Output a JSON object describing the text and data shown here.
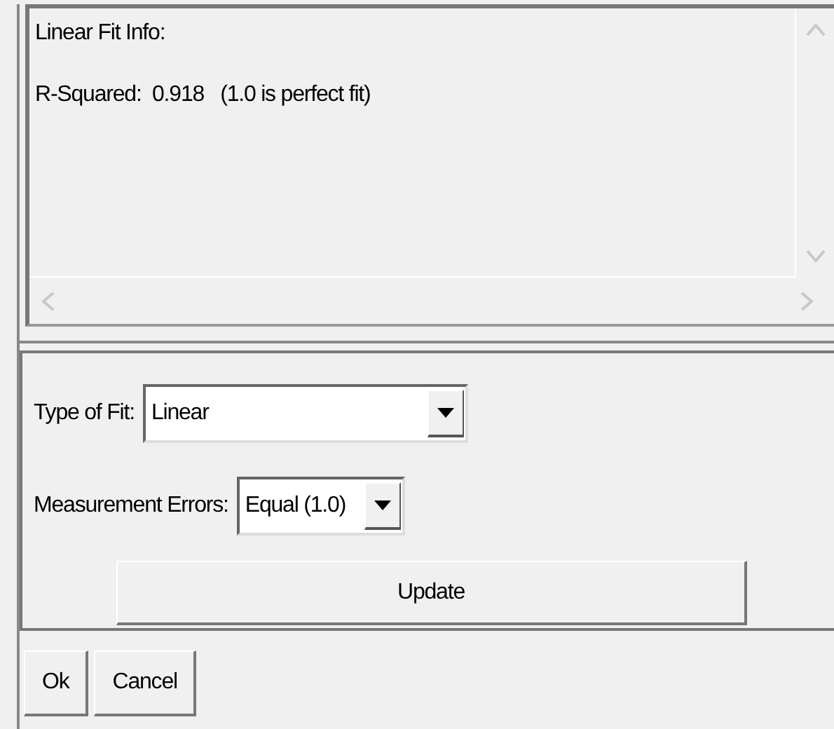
{
  "info_panel": {
    "lines": [
      "Linear Fit Info:",
      "R-Squared:  0.918   (1.0 is perfect fit)"
    ]
  },
  "fields": [
    {
      "label": "Type of Fit:",
      "value": "Linear",
      "kind": "wide"
    },
    {
      "label": "Measurement Errors:",
      "value": "Equal (1.0)",
      "kind": "narrow"
    }
  ],
  "update_button": "Update",
  "buttons": [
    "Ok",
    "Cancel"
  ]
}
